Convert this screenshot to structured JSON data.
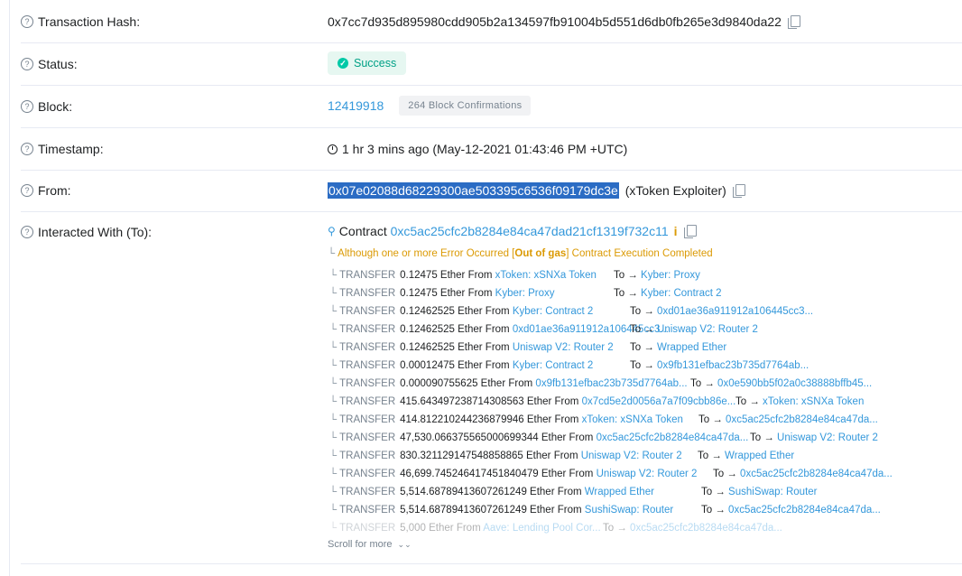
{
  "tx_hash": {
    "label": "Transaction Hash:",
    "value": "0x7cc7d935d895980cdd905b2a134597fb91004b5d551d6db0fb265e3d9840da22"
  },
  "status": {
    "label": "Status:",
    "value": "Success"
  },
  "block": {
    "label": "Block:",
    "number": "12419918",
    "confirmations": "264 Block Confirmations"
  },
  "timestamp": {
    "label": "Timestamp:",
    "value": "1 hr 3 mins ago (May-12-2021 01:43:46 PM +UTC)"
  },
  "from": {
    "label": "From:",
    "address": "0x07e02088d68229300ae503395c6536f09179dc3e",
    "name": "(xToken Exploiter)"
  },
  "interacted": {
    "label": "Interacted With (To):",
    "contract_label": "Contract",
    "contract_address": "0xc5ac25cfc2b8284e84ca47dad21cf1319f732c11",
    "warn_pre": "Although one or more Error Occurred [",
    "warn_bold": "Out of gas",
    "warn_post": "] Contract Execution Completed"
  },
  "transfer_label": "TRANSFER",
  "from_word": "From",
  "to_word": "To →",
  "transfers": [
    {
      "amount": "0.12475 Ether",
      "from": "xToken: xSNXa Token",
      "to": "Kyber: Proxy"
    },
    {
      "amount": "0.12475 Ether",
      "from": "Kyber: Proxy",
      "to": "Kyber: Contract 2"
    },
    {
      "amount": "0.12462525 Ether",
      "from": "Kyber: Contract 2",
      "to": "0xd01ae36a911912a106445cc3..."
    },
    {
      "amount": "0.12462525 Ether",
      "from": "0xd01ae36a911912a106445cc3...",
      "to": "Uniswap V2: Router 2"
    },
    {
      "amount": "0.12462525 Ether",
      "from": "Uniswap V2: Router 2",
      "to": "Wrapped Ether"
    },
    {
      "amount": "0.00012475 Ether",
      "from": "Kyber: Contract 2",
      "to": "0x9fb131efbac23b735d7764ab..."
    },
    {
      "amount": "0.000090755625 Ether",
      "from": "0x9fb131efbac23b735d7764ab...",
      "to": "0x0e590bb5f02a0c38888bffb45..."
    },
    {
      "amount": "415.643497238714308563 Ether",
      "from": "0x7cd5e2d0056a7a7f09cbb86e...",
      "to": "xToken: xSNXa Token"
    },
    {
      "amount": "414.812210244236879946 Ether",
      "from": "xToken: xSNXa Token",
      "to": "0xc5ac25cfc2b8284e84ca47da..."
    },
    {
      "amount": "47,530.066375565000699344 Ether",
      "from": "0xc5ac25cfc2b8284e84ca47da...",
      "to": "Uniswap V2: Router 2"
    },
    {
      "amount": "830.321129147548858865 Ether",
      "from": "Uniswap V2: Router 2",
      "to": "Wrapped Ether"
    },
    {
      "amount": "46,699.745246417451840479 Ether",
      "from": "Uniswap V2: Router 2",
      "to": "0xc5ac25cfc2b8284e84ca47da..."
    },
    {
      "amount": "5,514.68789413607261249 Ether",
      "from": "Wrapped Ether",
      "to": "SushiSwap: Router"
    },
    {
      "amount": "5,514.68789413607261249 Ether",
      "from": "SushiSwap: Router",
      "to": "0xc5ac25cfc2b8284e84ca47da..."
    },
    {
      "amount": "5,000 Ether",
      "from": "Aave: Lending Pool Cor...",
      "to": "0xc5ac25cfc2b8284e84ca47da..."
    }
  ],
  "scroll_more": "Scroll for more"
}
